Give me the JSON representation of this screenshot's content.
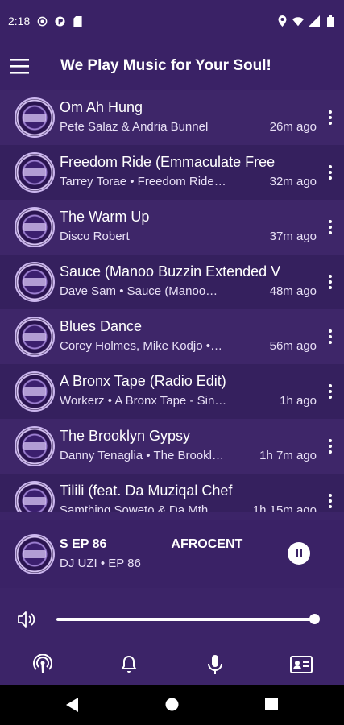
{
  "status_bar": {
    "time": "2:18"
  },
  "header": {
    "title": "We Play Music for Your Soul!"
  },
  "tracks": [
    {
      "title": "Om Ah Hung",
      "subtitle": "Pete Salaz & Andria Bunnel",
      "time": "26m ago"
    },
    {
      "title": "Freedom Ride (Emmaculate Free",
      "subtitle": "Tarrey Torae • Freedom Ride…",
      "time": "32m ago"
    },
    {
      "title": "The Warm Up",
      "subtitle": "Disco Robert",
      "time": "37m ago"
    },
    {
      "title": "Sauce (Manoo Buzzin Extended V",
      "subtitle": "Dave   Sam • Sauce (Manoo…",
      "time": "48m ago"
    },
    {
      "title": "Blues Dance",
      "subtitle": "Corey Holmes, Mike Kodjo •…",
      "time": "56m ago"
    },
    {
      "title": "A Bronx Tape (Radio Edit)",
      "subtitle": "Workerz • A Bronx Tape - Sin…",
      "time": "1h ago"
    },
    {
      "title": "The Brooklyn Gypsy",
      "subtitle": "Danny Tenaglia • The Brookl…",
      "time": "1h 7m ago"
    },
    {
      "title": "Tilili (feat. Da Muziqal Chef",
      "subtitle": "Samthing Soweto & Da Mth…",
      "time": "1h 15m ago"
    }
  ],
  "now_playing": {
    "title_part1": "S EP 86",
    "title_part2": "AFROCENT",
    "subtitle": "DJ UZI • EP 86",
    "progress": 1.0
  },
  "volume": {
    "level": 1.0
  },
  "icons": {
    "menu": "hamburger-menu-icon",
    "more": "more-vert-icon",
    "pause": "pause-icon",
    "volume": "volume-icon",
    "nav": [
      "podcast-icon",
      "bell-icon",
      "microphone-icon",
      "contact-card-icon"
    ]
  },
  "colors": {
    "background": "#3c2468",
    "row_alt": "#35205e",
    "accent": "#ffffff"
  }
}
